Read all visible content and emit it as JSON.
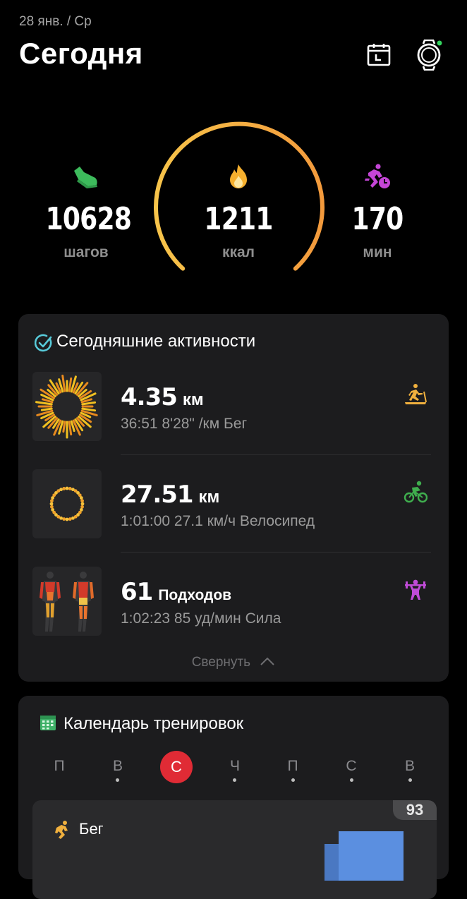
{
  "header": {
    "date": "28 янв. / Ср",
    "title": "Сегодня"
  },
  "stats": {
    "steps": {
      "value": "10628",
      "label": "шагов",
      "icon": "shoe-icon",
      "color": "#3dbb5c"
    },
    "calories": {
      "value": "1211",
      "label": "ккал",
      "icon": "flame-icon",
      "color": "#f5b731"
    },
    "minutes": {
      "value": "170",
      "label": "мин",
      "icon": "running-clock-icon",
      "color": "#c445d6"
    },
    "gauge_colors": [
      "#f7b23b",
      "#f59a3c"
    ]
  },
  "activities": {
    "title": "Сегодняшние активности",
    "items": [
      {
        "value": "4.35",
        "unit": "км",
        "details": "36:51  8'28\" /км Бег",
        "icon": "treadmill-icon",
        "color": "#f0b03e"
      },
      {
        "value": "27.51",
        "unit": "км",
        "details": "1:01:00  27.1 км/ч Велосипед",
        "icon": "cycling-icon",
        "color": "#3fae4e"
      },
      {
        "value": "61",
        "unit": "Подходов",
        "details": "1:02:23 85 уд/мин Сила",
        "icon": "weightlifting-icon",
        "color": "#c04bd8"
      }
    ],
    "collapse_label": "Свернуть"
  },
  "calendar": {
    "title": "Календарь тренировок",
    "days": [
      "П",
      "В",
      "С",
      "Ч",
      "П",
      "С",
      "В"
    ],
    "today_index": 2,
    "workout": {
      "label": "Бег",
      "badge": "93"
    }
  }
}
